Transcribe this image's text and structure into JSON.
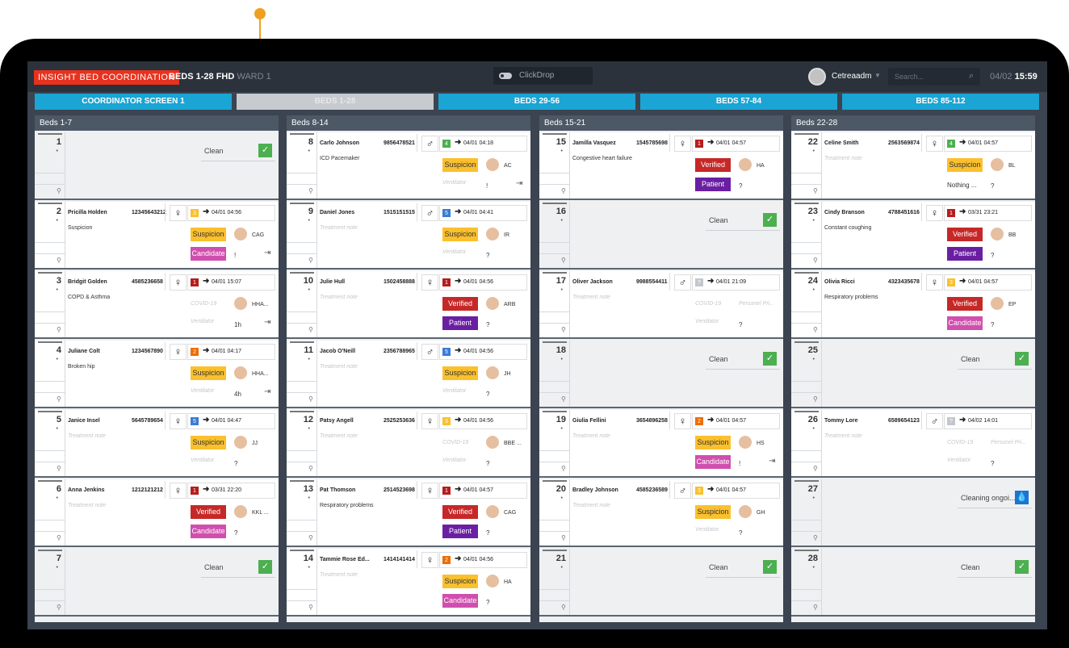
{
  "header": {
    "logo": "INSIGHT BED COORDINATION",
    "ward": "BEDS 1-28 FHD",
    "ward_sub": "WARD 1",
    "clickdrop": "ClickDrop",
    "user": "Cetreaadm",
    "search_placeholder": "Search...",
    "date": "04/02",
    "time": "15:59"
  },
  "tabs": [
    "COORDINATOR SCREEN 1",
    "BEDS 1-28",
    "BEDS 29-56",
    "BEDS 57-84",
    "BEDS 85-112"
  ],
  "columns": [
    {
      "title": "Beds 1-7"
    },
    {
      "title": "Beds 8-14"
    },
    {
      "title": "Beds 15-21"
    },
    {
      "title": "Beds 22-28"
    }
  ],
  "labels": {
    "clean": "Clean",
    "cleaning": "Cleaning ongoi...",
    "treatment_note": "Treatment note",
    "ventilator": "Ventilator",
    "covid": "COVID-19",
    "personel": "Personel Pri...",
    "nothing": "Nothing ...",
    "check": "✓",
    "drop": "💧"
  },
  "beds": [
    {
      "n": "1",
      "clean": true
    },
    {
      "n": "2",
      "name": "Pricilla Holden",
      "id": "12345643212",
      "g": "♀",
      "tri": "3",
      "tc": "#fbc02d",
      "adm": "04/01 04:56",
      "note": "Suspicion",
      "t1": "Suspicion",
      "t2": "Candidate",
      "init": "CAG",
      "q": "!",
      "exit": true
    },
    {
      "n": "3",
      "name": "Bridgit Golden",
      "id": "4585236658",
      "g": "♀",
      "tri": "1",
      "tc": "#b71c1c",
      "adm": "04/01 15:07",
      "note": "COPD & Asthma",
      "t1": "COVID-19",
      "t2": "Ventilator",
      "init": "HHA...",
      "q": "1h",
      "exit": true
    },
    {
      "n": "4",
      "name": "Juliane Colt",
      "id": "1234567890",
      "g": "♀",
      "tri": "2",
      "tc": "#ef6c00",
      "adm": "04/01 04:17",
      "note": "Broken hip",
      "t1": "Suspicion",
      "t2": "Ventilator",
      "init": "HHA...",
      "q": "4h",
      "exit": true
    },
    {
      "n": "5",
      "name": "Janice Insel",
      "id": "5645789654",
      "g": "♀",
      "tri": "5",
      "tc": "#3a7bd5",
      "adm": "04/01 04:47",
      "note": "",
      "t1": "Suspicion",
      "t2": "Ventilator",
      "init": "JJ",
      "q": "?"
    },
    {
      "n": "6",
      "name": "Anna Jenkins",
      "id": "1212121212",
      "g": "♀",
      "tri": "1",
      "tc": "#b71c1c",
      "adm": "03/31 22:20",
      "note": "",
      "t1": "Verified",
      "t2": "Candidate",
      "init": "KKL ...",
      "q": "?"
    },
    {
      "n": "7",
      "clean": true
    },
    {
      "n": "8",
      "name": "Carlo Johnson",
      "id": "9856478521",
      "g": "♂",
      "tri": "4",
      "tc": "#4caf50",
      "adm": "04/01 04:18",
      "note": "ICD Pacemaker",
      "t1": "Suspicion",
      "t2": "Ventilator",
      "init": "AC",
      "q": "!",
      "exit": true
    },
    {
      "n": "9",
      "name": "Daniel Jones",
      "id": "1515151515",
      "g": "♂",
      "tri": "5",
      "tc": "#3a7bd5",
      "adm": "04/01 04:41",
      "note": "",
      "t1": "Suspicion",
      "t2": "Ventilator",
      "init": "IR",
      "q": "?"
    },
    {
      "n": "10",
      "name": "Julie Hull",
      "id": "1502458888",
      "g": "♀",
      "tri": "1",
      "tc": "#b71c1c",
      "adm": "04/01 04:56",
      "note": "",
      "t1": "Verified",
      "t2": "Patient",
      "init": "ARB",
      "q": "?"
    },
    {
      "n": "11",
      "name": "Jacob O'Neill",
      "id": "2356788965",
      "g": "♂",
      "tri": "5",
      "tc": "#3a7bd5",
      "adm": "04/01 04:56",
      "note": "",
      "t1": "Suspicion",
      "t2": "Ventilator",
      "init": "JH",
      "q": "?"
    },
    {
      "n": "12",
      "name": "Patsy Angell",
      "id": "2525253636",
      "g": "♀",
      "tri": "3",
      "tc": "#fbc02d",
      "adm": "04/01 04:56",
      "note": "",
      "t1": "COVID-19",
      "t2": "Ventilator",
      "init": "BBE ...",
      "q": "?"
    },
    {
      "n": "13",
      "name": "Pat Thomson",
      "id": "2514523698",
      "g": "♀",
      "tri": "1",
      "tc": "#b71c1c",
      "adm": "04/01 04:57",
      "note": "Respiratory problems",
      "t1": "Verified",
      "t2": "Patient",
      "init": "CAG",
      "q": "?"
    },
    {
      "n": "14",
      "name": "Tammie Rose Ed...",
      "id": "1414141414",
      "g": "♀",
      "tri": "2",
      "tc": "#ef6c00",
      "adm": "04/01 04:56",
      "note": "",
      "t1": "Suspicion",
      "t2": "Candidate",
      "init": "HA",
      "q": "?"
    },
    {
      "n": "15",
      "name": "Jamilla Vasquez",
      "id": "1545785698",
      "g": "♀",
      "tri": "1",
      "tc": "#b71c1c",
      "adm": "04/01 04:57",
      "note": "Congestive heart failure",
      "t1": "Verified",
      "t2": "Patient",
      "init": "HA",
      "q": "?"
    },
    {
      "n": "16",
      "clean": true
    },
    {
      "n": "17",
      "name": "Oliver Jackson",
      "id": "9988554411",
      "g": "♂",
      "tri": "?",
      "tc": "#c3c7cc",
      "adm": "04/01 21:09",
      "note": "",
      "t1": "COVID-19",
      "t2": "Ventilator",
      "init": "Personel Pri...",
      "q": "?"
    },
    {
      "n": "18",
      "clean": true
    },
    {
      "n": "19",
      "name": "Giulia Fellini",
      "id": "3654896258",
      "g": "♀",
      "tri": "2",
      "tc": "#ef6c00",
      "adm": "04/01 04:57",
      "note": "",
      "t1": "Suspicion",
      "t2": "Candidate",
      "init": "HS",
      "q": "!",
      "exit": true
    },
    {
      "n": "20",
      "name": "Bradley Johnson",
      "id": "4585236589",
      "g": "♂",
      "tri": "3",
      "tc": "#fbc02d",
      "adm": "04/01 04:57",
      "note": "",
      "t1": "Suspicion",
      "t2": "Ventilator",
      "init": "GH",
      "q": "?"
    },
    {
      "n": "21",
      "clean": true
    },
    {
      "n": "22",
      "name": "Celine Smith",
      "id": "2563569874",
      "g": "♀",
      "tri": "4",
      "tc": "#4caf50",
      "adm": "04/01 04:57",
      "note": "",
      "t1": "Suspicion",
      "t2": "Nothing ...",
      "init": "BL",
      "q": "?"
    },
    {
      "n": "23",
      "name": "Cindy Branson",
      "id": "4788451616",
      "g": "♀",
      "tri": "1",
      "tc": "#b71c1c",
      "adm": "03/31 23:21",
      "note": "Constant coughing",
      "t1": "Verified",
      "t2": "Patient",
      "init": "BB",
      "q": "?"
    },
    {
      "n": "24",
      "name": "Olivia Ricci",
      "id": "4323435678",
      "g": "♀",
      "tri": "3",
      "tc": "#fbc02d",
      "adm": "04/01 04:57",
      "note": "Respiratory problems",
      "t1": "Verified",
      "t2": "Candidate",
      "init": "EP",
      "q": "?"
    },
    {
      "n": "25",
      "clean": true
    },
    {
      "n": "26",
      "name": "Tommy Lore",
      "id": "6589654123",
      "g": "♂",
      "tri": "?",
      "tc": "#c3c7cc",
      "adm": "04/02 14:01",
      "note": "",
      "t1": "COVID-19",
      "t2": "Ventilator",
      "init": "Personel Pri...",
      "q": "?"
    },
    {
      "n": "27",
      "cleaning": true
    },
    {
      "n": "28",
      "clean": true
    }
  ]
}
